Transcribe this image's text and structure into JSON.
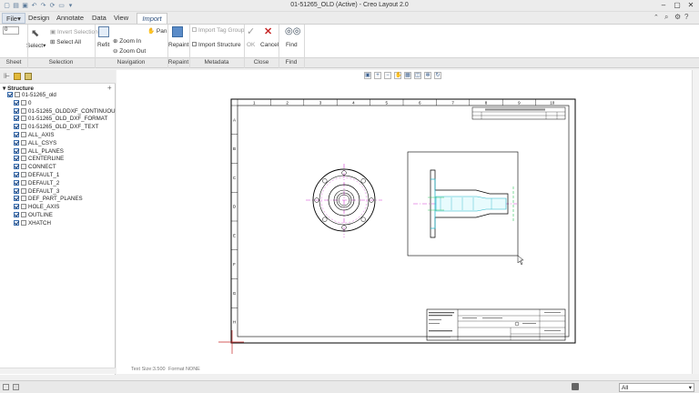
{
  "window": {
    "title": "01-51265_OLD (Active) - Creo Layout 2.0"
  },
  "quick_access": [
    "new-icon",
    "open-icon",
    "save-icon",
    "undo-icon",
    "redo-icon",
    "regenerate-icon",
    "window-icon",
    "more-icon"
  ],
  "menu": {
    "tabs": [
      "File",
      "Design",
      "Annotate",
      "Data",
      "View",
      "Import"
    ],
    "active": "Import"
  },
  "ribbon": {
    "sheet_value": "0",
    "select_label": "Select",
    "invert_selection": "Invert Selection",
    "select_all": "Select All",
    "refit": "Refit",
    "pan": "Pan",
    "zoom_in": "Zoom In",
    "zoom_out": "Zoom Out",
    "repaint": "Repaint",
    "import_tag_group": "Import Tag Group",
    "import_structure": "Import Structure",
    "ok": "OK",
    "cancel": "Cancel",
    "find": "Find"
  },
  "groups": [
    "Sheet",
    "Selection",
    "Navigation",
    "Repaint",
    "Metadata",
    "Close",
    "Find"
  ],
  "structure": {
    "header": "Structure",
    "root": "01-51265_old",
    "items": [
      "0",
      "01-51265_OLDDXF_CONTINUOU",
      "01-51265_OLD_DXF_FORMAT",
      "01-51265_OLD_DXF_TEXT",
      "ALL_AXIS",
      "ALL_CSYS",
      "ALL_PLANES",
      "CENTERLINE",
      "CONNECT",
      "DEFAULT_1",
      "DEFAULT_2",
      "DEFAULT_3",
      "DEF_PART_PLANES",
      "HOLE_AXIS",
      "OUTLINE",
      "XHATCH"
    ]
  },
  "canvas": {
    "text_size": "Text Size:3.500",
    "format": "Format NONE",
    "border_numbers": [
      "1",
      "2",
      "3",
      "4",
      "5",
      "6",
      "7",
      "8",
      "9",
      "10"
    ],
    "border_letters": [
      "A",
      "B",
      "C",
      "D",
      "E",
      "F",
      "G",
      "H"
    ]
  },
  "status": {
    "filter": "All"
  },
  "colors": {
    "accent": "#2d4f7d",
    "cancel_red": "#c62828",
    "ok_green": "#9a9a9a",
    "drawing_line": "#000000",
    "hidden_line": "#d23cd2",
    "section_fill": "#23b5c9"
  }
}
